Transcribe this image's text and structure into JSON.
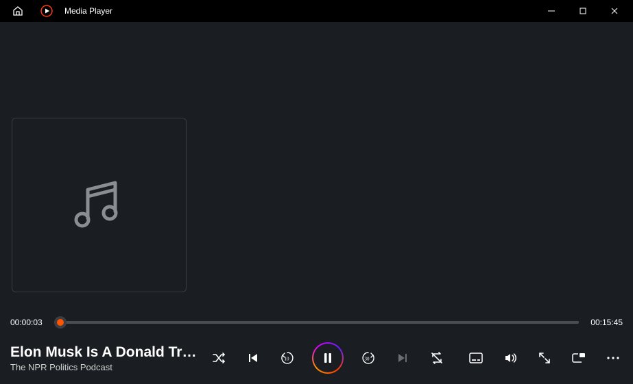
{
  "titlebar": {
    "app_title": "Media Player"
  },
  "playback": {
    "elapsed": "00:00:03",
    "total": "00:15:45"
  },
  "track": {
    "title": "Elon Musk Is A Donald Trum...",
    "artist": "The NPR Politics Podcast"
  }
}
